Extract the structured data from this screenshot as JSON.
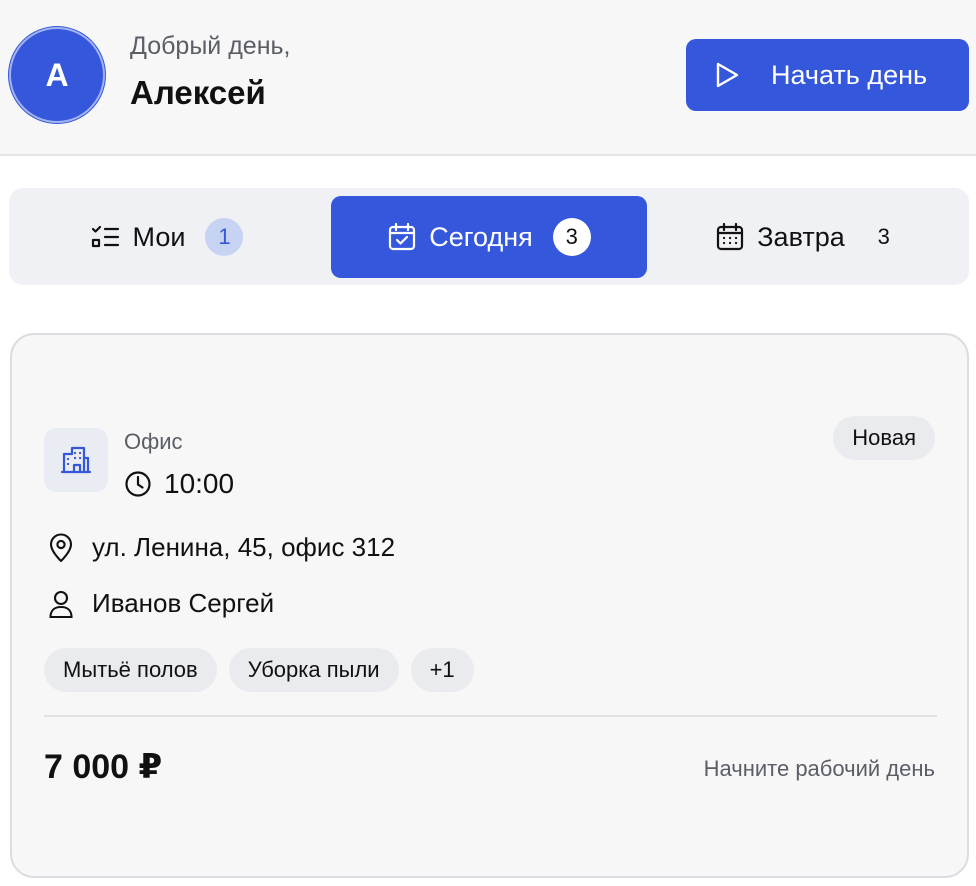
{
  "header": {
    "avatar_initial": "А",
    "greeting": "Добрый день,",
    "user_name": "Алексей",
    "start_button_label": "Начать день",
    "accent_color": "#3457dc"
  },
  "tabs": [
    {
      "label": "Мои",
      "count": "1",
      "icon": "checklist-icon",
      "active": false
    },
    {
      "label": "Сегодня",
      "count": "3",
      "icon": "calendar-check-icon",
      "active": true
    },
    {
      "label": "Завтра",
      "count": "3",
      "icon": "calendar-grid-icon",
      "active": false
    }
  ],
  "order_card": {
    "type": "Офис",
    "type_icon": "building-icon",
    "time": "10:00",
    "status": "Новая",
    "address": "ул. Ленина, 45, офис 312",
    "client": "Иванов Сергей",
    "services": [
      "Мытьё полов",
      "Уборка пыли"
    ],
    "more_services": "+1",
    "price": "7 000 ₽",
    "hint": "Начните рабочий день"
  }
}
